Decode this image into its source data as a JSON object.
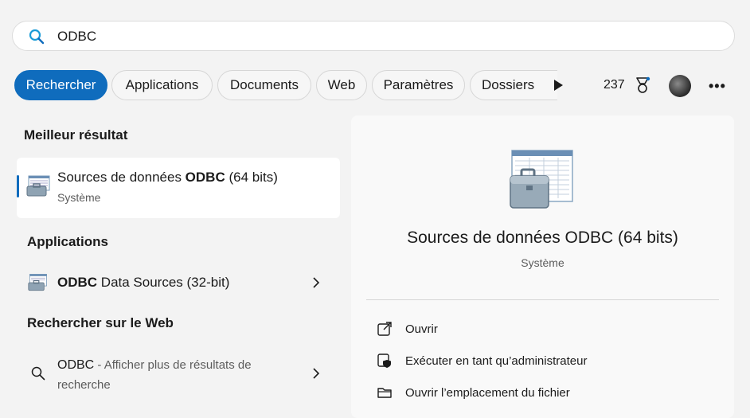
{
  "search": {
    "value": "ODBC"
  },
  "tabs": [
    {
      "label": "Rechercher"
    },
    {
      "label": "Applications"
    },
    {
      "label": "Documents"
    },
    {
      "label": "Web"
    },
    {
      "label": "Paramètres"
    },
    {
      "label": "Dossiers"
    }
  ],
  "header": {
    "points": "237"
  },
  "best_match": {
    "heading": "Meilleur résultat",
    "title_pre": "Sources de données ",
    "title_bold": "ODBC",
    "title_post": " (64 bits)",
    "subtitle": "Système"
  },
  "apps": {
    "heading": "Applications",
    "items": [
      {
        "title_bold": "ODBC",
        "title_post": " Data Sources (32-bit)"
      }
    ]
  },
  "web": {
    "heading": "Rechercher sur le Web",
    "query": "ODBC",
    "hint": " - Afficher plus de résultats de recherche"
  },
  "preview": {
    "title": "Sources de données ODBC (64 bits)",
    "subtitle": "Système",
    "actions": [
      {
        "label": "Ouvrir",
        "icon": "open-external-icon"
      },
      {
        "label": "Exécuter en tant qu’administrateur",
        "icon": "shield-admin-icon"
      },
      {
        "label": "Ouvrir l’emplacement du fichier",
        "icon": "folder-icon"
      }
    ]
  },
  "colors": {
    "accent": "#0f6cbd",
    "search_icon": "#1a9bd7"
  }
}
